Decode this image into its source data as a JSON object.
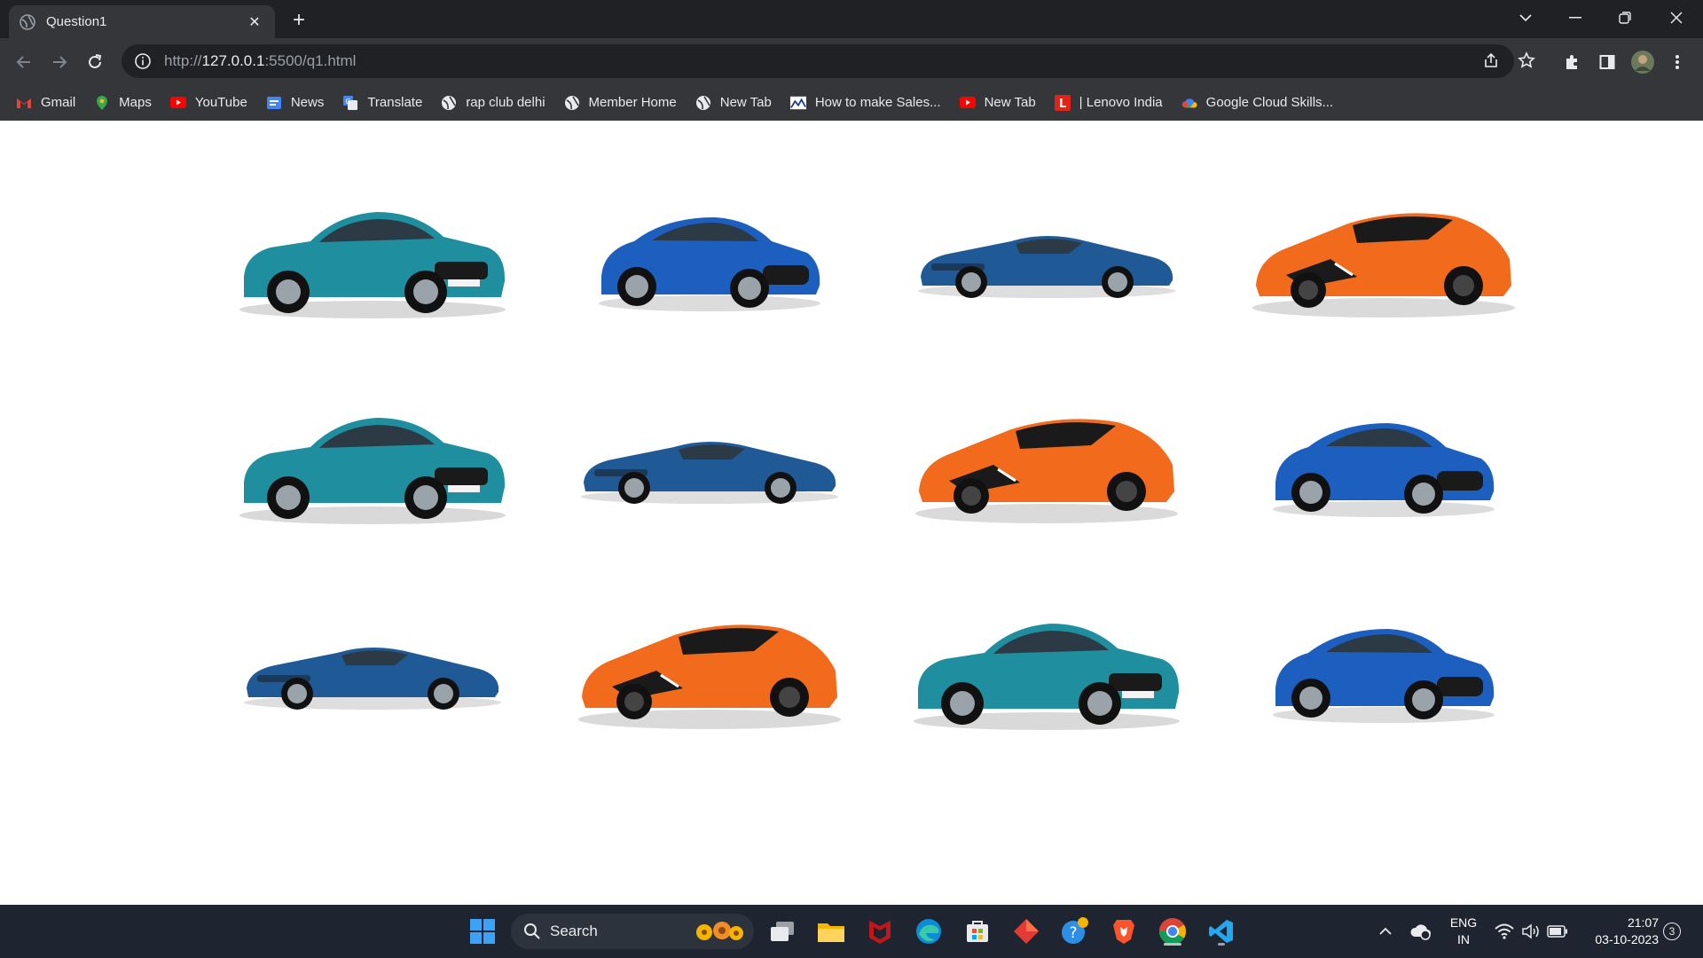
{
  "browser": {
    "tab": {
      "title": "Question1",
      "favicon": "globe-icon"
    },
    "url": {
      "scheme": "http://",
      "host": "127.0.0.1",
      "rest": ":5500/q1.html"
    }
  },
  "bookmarks": [
    {
      "label": "Gmail",
      "icon": "gmail-icon",
      "color": "#ea4335"
    },
    {
      "label": "Maps",
      "icon": "maps-icon",
      "color": "#34a853"
    },
    {
      "label": "YouTube",
      "icon": "youtube-icon",
      "color": "#ff0000"
    },
    {
      "label": "News",
      "icon": "news-icon",
      "color": "#4285f4"
    },
    {
      "label": "Translate",
      "icon": "translate-icon",
      "color": "#4285f4"
    },
    {
      "label": "rap club delhi",
      "icon": "globe-icon",
      "color": "#e8eaed"
    },
    {
      "label": "Member Home",
      "icon": "globe-icon",
      "color": "#e8eaed"
    },
    {
      "label": "New Tab",
      "icon": "globe-icon",
      "color": "#e8eaed"
    },
    {
      "label": "How to make Sales...",
      "icon": "chart-icon",
      "color": "#e8eaed"
    },
    {
      "label": "New Tab",
      "icon": "youtube-icon",
      "color": "#ff0000"
    },
    {
      "label": "| Lenovo India",
      "icon": "lenovo-icon",
      "color": "#e2231a"
    },
    {
      "label": "Google Cloud Skills...",
      "icon": "cloud-icon",
      "color": "#fbbc04"
    }
  ],
  "cars": [
    {
      "model": "sedan",
      "color": "#1f8fa0"
    },
    {
      "model": "coupe",
      "color": "#1d5fbf"
    },
    {
      "model": "gt",
      "color": "#1f5a96"
    },
    {
      "model": "supercar",
      "color": "#f26a1b"
    },
    {
      "model": "sedan",
      "color": "#1f8fa0"
    },
    {
      "model": "gt",
      "color": "#1f5a96"
    },
    {
      "model": "supercar",
      "color": "#f26a1b"
    },
    {
      "model": "coupe",
      "color": "#1d5fbf"
    },
    {
      "model": "gt",
      "color": "#1f5a96"
    },
    {
      "model": "supercar",
      "color": "#f26a1b"
    },
    {
      "model": "sedan",
      "color": "#1f8fa0"
    },
    {
      "model": "coupe",
      "color": "#1d5fbf"
    }
  ],
  "taskbar": {
    "search_label": "Search",
    "language": "ENG",
    "region": "IN",
    "time": "21:07",
    "date": "03-10-2023",
    "notification_count": "3"
  }
}
